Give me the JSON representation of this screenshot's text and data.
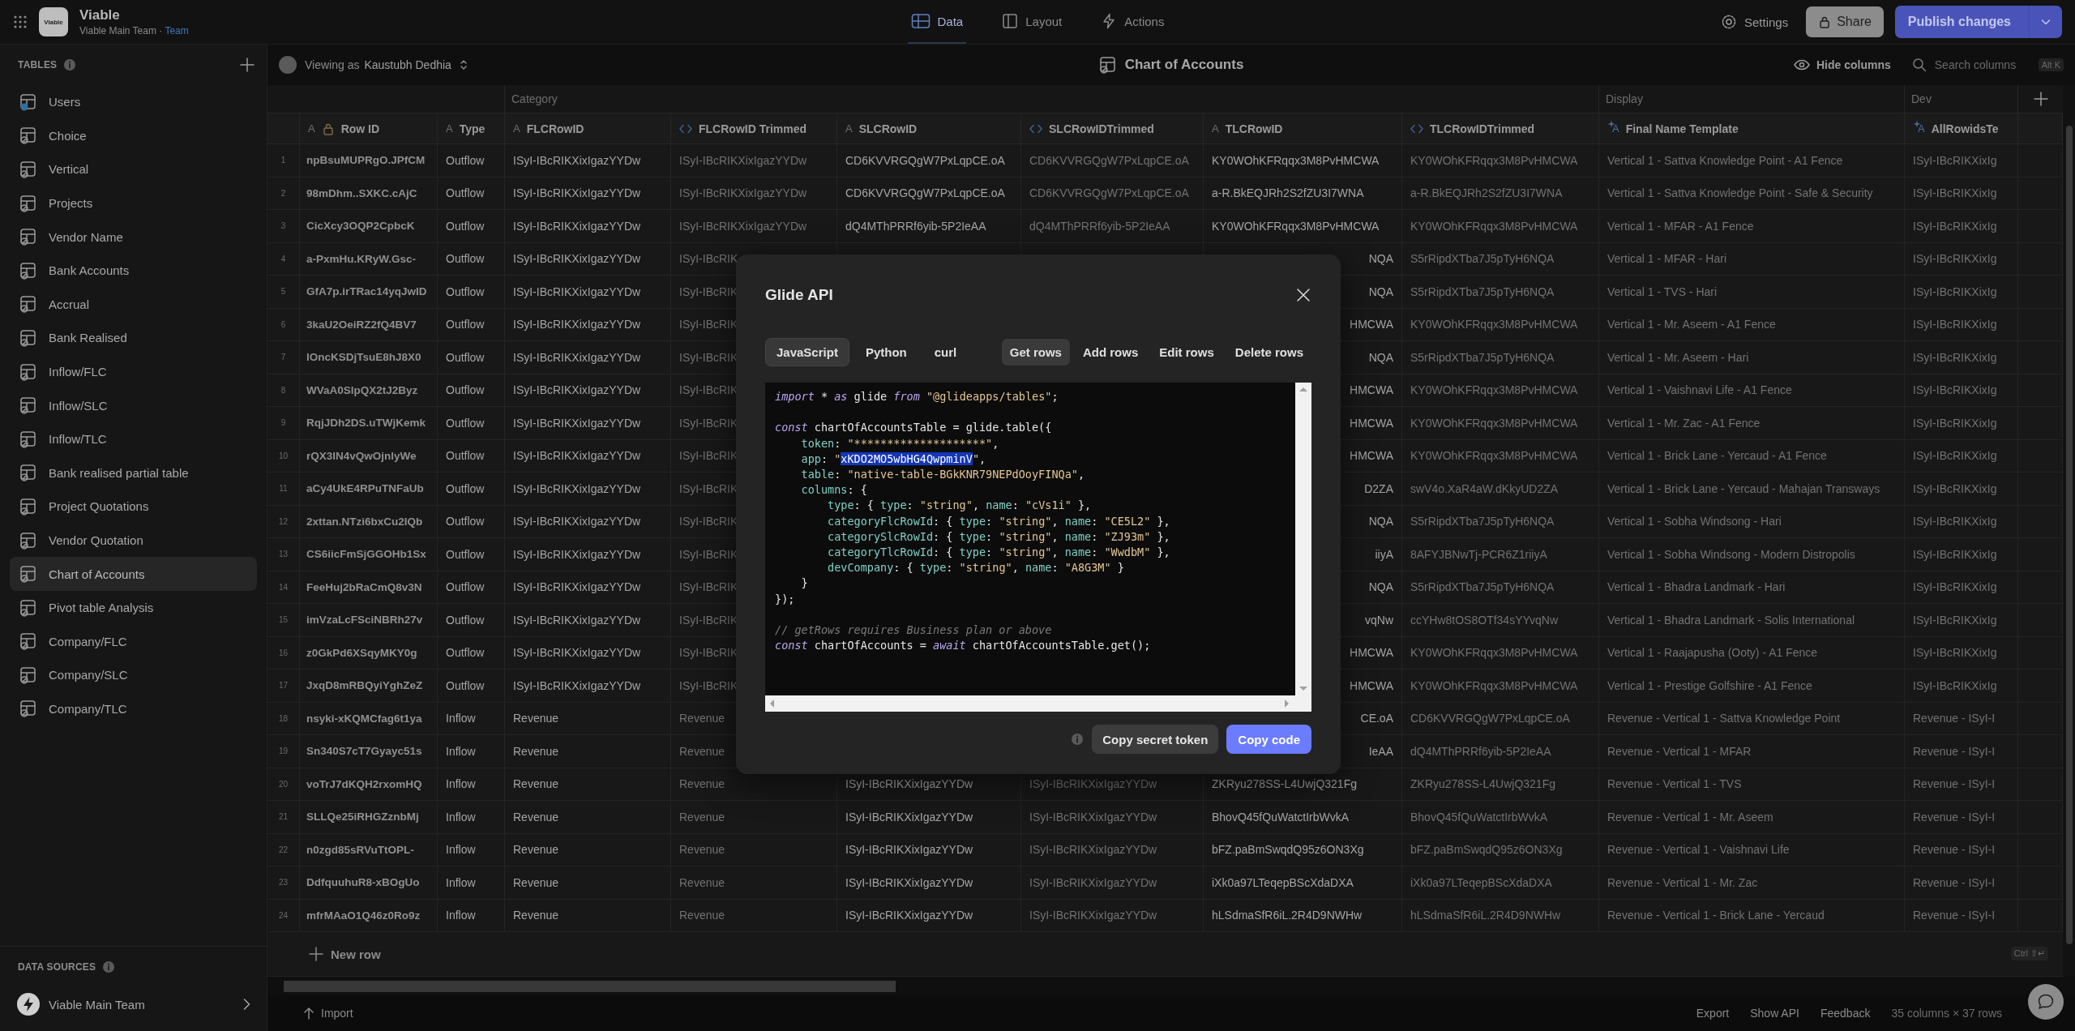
{
  "app": {
    "logo_text": "Viable",
    "name": "Viable",
    "team": "Viable Main Team",
    "dot": "·",
    "plan": "Team"
  },
  "nav": [
    {
      "label": "Data",
      "kind": "data",
      "selected": true
    },
    {
      "label": "Layout",
      "kind": "layout",
      "selected": false
    },
    {
      "label": "Actions",
      "kind": "actions",
      "selected": false
    }
  ],
  "header_actions": {
    "settings": "Settings",
    "share": "Share",
    "publish": "Publish changes"
  },
  "sidebar": {
    "title": "TABLES",
    "items": [
      {
        "label": "Users",
        "kind": "users",
        "selected": false
      },
      {
        "label": "Choice",
        "kind": "table",
        "selected": false
      },
      {
        "label": "Vertical",
        "kind": "table",
        "selected": false
      },
      {
        "label": "Projects",
        "kind": "table",
        "selected": false
      },
      {
        "label": "Vendor Name",
        "kind": "table",
        "selected": false
      },
      {
        "label": "Bank Accounts",
        "kind": "table",
        "selected": false
      },
      {
        "label": "Accrual",
        "kind": "table",
        "selected": false
      },
      {
        "label": "Bank Realised",
        "kind": "table",
        "selected": false
      },
      {
        "label": "Inflow/FLC",
        "kind": "table",
        "selected": false
      },
      {
        "label": "Inflow/SLC",
        "kind": "table",
        "selected": false
      },
      {
        "label": "Inflow/TLC",
        "kind": "table",
        "selected": false
      },
      {
        "label": "Bank realised partial table",
        "kind": "table",
        "selected": false
      },
      {
        "label": "Project Quotations",
        "kind": "table",
        "selected": false
      },
      {
        "label": "Vendor Quotation",
        "kind": "table",
        "selected": false
      },
      {
        "label": "Chart of Accounts",
        "kind": "table",
        "selected": true
      },
      {
        "label": "Pivot table Analysis",
        "kind": "table",
        "selected": false
      },
      {
        "label": "Company/FLC",
        "kind": "table",
        "selected": false
      },
      {
        "label": "Company/SLC",
        "kind": "table",
        "selected": false
      },
      {
        "label": "Company/TLC",
        "kind": "table",
        "selected": false
      }
    ],
    "data_sources_title": "DATA SOURCES",
    "source": "Viable Main Team"
  },
  "toolbar": {
    "viewing_prefix": "Viewing as",
    "viewer": "Kaustubh Dedhia",
    "table_title": "Chart of Accounts",
    "hide_columns": "Hide columns",
    "search_placeholder": "Search columns",
    "shortcut": "Alt K"
  },
  "table": {
    "column_sets": [
      {
        "columns": [
          {
            "label": "Row ID",
            "kind": "text",
            "glyph": "A",
            "locked": true
          },
          {
            "label": "Type",
            "kind": "text",
            "glyph": "A",
            "locked": false
          }
        ]
      },
      {
        "label": "Category",
        "columns": [
          {
            "label": "FLCRowID",
            "kind": "text",
            "glyph": "A",
            "locked": false
          },
          {
            "label": "FLCRowID Trimmed",
            "kind": "computed",
            "locked": false
          },
          {
            "label": "SLCRowID",
            "kind": "text",
            "glyph": "A",
            "locked": false
          },
          {
            "label": "SLCRowIDTrimmed",
            "kind": "computed",
            "locked": false
          },
          {
            "label": "TLCRowID",
            "kind": "text",
            "glyph": "A",
            "locked": false
          },
          {
            "label": "TLCRowIDTrimmed",
            "kind": "computed",
            "locked": false
          }
        ]
      },
      {
        "label": "Display",
        "columns": [
          {
            "label": "Final Name Template",
            "kind": "template",
            "glyph": "A",
            "locked": false
          }
        ]
      },
      {
        "label": "Dev",
        "columns": [
          {
            "label": "AllRowidsTe",
            "kind": "template",
            "glyph": "A",
            "locked": false
          }
        ]
      }
    ],
    "rows": [
      {
        "num": "1",
        "cells": [
          "npBsuMUPRgO.JPfCM",
          "Outflow",
          "ISyI-IBcRIKXixIgazYYDw",
          "ISyI-IBcRIKXixIgazYYDw",
          "CD6KVVRGQgW7PxLqpCE.oA",
          "CD6KVVRGQgW7PxLqpCE.oA",
          "KY0WOhKFRqqx3M8PvHMCWA",
          "KY0WOhKFRqqx3M8PvHMCWA",
          "Vertical 1 - Sattva Knowledge Point - A1 Fence",
          "ISyI-IBcRIKXixIg"
        ]
      },
      {
        "num": "2",
        "cells": [
          "98mDhm..SXKC.cAjC",
          "Outflow",
          "ISyI-IBcRIKXixIgazYYDw",
          "ISyI-IBcRIKXixIgazYYDw",
          "CD6KVVRGQgW7PxLqpCE.oA",
          "CD6KVVRGQgW7PxLqpCE.oA",
          "a-R.BkEQJRh2S2fZU3I7WNA",
          "a-R.BkEQJRh2S2fZU3I7WNA",
          "Vertical 1 - Sattva Knowledge Point - Safe & Security",
          "ISyI-IBcRIKXixIg"
        ]
      },
      {
        "num": "3",
        "cells": [
          "CicXcy3OQP2CpbcK",
          "Outflow",
          "ISyI-IBcRIKXixIgazYYDw",
          "ISyI-IBcRIKXixIgazYYDw",
          "dQ4MThPRRf6yib-5P2IeAA",
          "dQ4MThPRRf6yib-5P2IeAA",
          "KY0WOhKFRqqx3M8PvHMCWA",
          "KY0WOhKFRqqx3M8PvHMCWA",
          "Vertical 1 - MFAR - A1 Fence",
          "ISyI-IBcRIKXixIg"
        ]
      },
      {
        "num": "4",
        "cells": [
          "a-PxmHu.KRyW.Gsc-",
          "Outflow",
          "ISyI-IBcRIKXixIgazYYDw",
          "ISyI-IBcRIK",
          null,
          null,
          {
            "text": "NQA",
            "cut_left": true
          },
          "S5rRipdXTba7J5pTyH6NQA",
          "Vertical 1 - MFAR - Hari",
          "ISyI-IBcRIKXixIg"
        ]
      },
      {
        "num": "5",
        "cells": [
          "GfA7p.irTRac14yqJwID",
          "Outflow",
          "ISyI-IBcRIKXixIgazYYDw",
          "ISyI-IBcRIK",
          null,
          null,
          {
            "text": "NQA",
            "cut_left": true
          },
          "S5rRipdXTba7J5pTyH6NQA",
          "Vertical 1 - TVS - Hari",
          "ISyI-IBcRIKXixIg"
        ]
      },
      {
        "num": "6",
        "cells": [
          "3kaU2OeiRZ2fQ4BV7",
          "Outflow",
          "ISyI-IBcRIKXixIgazYYDw",
          "ISyI-IBcRIK",
          null,
          null,
          {
            "text": "HMCWA",
            "cut_left": true
          },
          "KY0WOhKFRqqx3M8PvHMCWA",
          "Vertical 1 - Mr. Aseem - A1 Fence",
          "ISyI-IBcRIKXixIg"
        ]
      },
      {
        "num": "7",
        "cells": [
          "lOncKSDjTsuE8hJ8X0",
          "Outflow",
          "ISyI-IBcRIKXixIgazYYDw",
          "ISyI-IBcRIK",
          null,
          null,
          {
            "text": "NQA",
            "cut_left": true
          },
          "S5rRipdXTba7J5pTyH6NQA",
          "Vertical 1 - Mr. Aseem - Hari",
          "ISyI-IBcRIKXixIg"
        ]
      },
      {
        "num": "8",
        "cells": [
          "WVaA0SlpQX2tJ2Byz",
          "Outflow",
          "ISyI-IBcRIKXixIgazYYDw",
          "ISyI-IBcRIK",
          null,
          null,
          {
            "text": "HMCWA",
            "cut_left": true
          },
          "KY0WOhKFRqqx3M8PvHMCWA",
          "Vertical 1 - Vaishnavi Life - A1 Fence",
          "ISyI-IBcRIKXixIg"
        ]
      },
      {
        "num": "9",
        "cells": [
          "RqjJDh2DS.uTWjKemk",
          "Outflow",
          "ISyI-IBcRIKXixIgazYYDw",
          "ISyI-IBcRIK",
          null,
          null,
          {
            "text": "HMCWA",
            "cut_left": true
          },
          "KY0WOhKFRqqx3M8PvHMCWA",
          "Vertical 1 - Mr. Zac - A1 Fence",
          "ISyI-IBcRIKXixIg"
        ]
      },
      {
        "num": "10",
        "cells": [
          "rQX3IN4vQwOjnlyWe",
          "Outflow",
          "ISyI-IBcRIKXixIgazYYDw",
          "ISyI-IBcRIK",
          null,
          null,
          {
            "text": "HMCWA",
            "cut_left": true
          },
          "KY0WOhKFRqqx3M8PvHMCWA",
          "Vertical 1 - Brick Lane - Yercaud - A1 Fence",
          "ISyI-IBcRIKXixIg"
        ]
      },
      {
        "num": "11",
        "cells": [
          "aCy4UkE4RPuTNFaUb",
          "Outflow",
          "ISyI-IBcRIKXixIgazYYDw",
          "ISyI-IBcRIK",
          null,
          null,
          {
            "text": "D2ZA",
            "cut_left": true
          },
          "swV4o.XaR4aW.dKkyUD2ZA",
          "Vertical 1 - Brick Lane - Yercaud - Mahajan Transways",
          "ISyI-IBcRIKXixIg"
        ]
      },
      {
        "num": "12",
        "cells": [
          "2xttan.NTzi6bxCu2IQb",
          "Outflow",
          "ISyI-IBcRIKXixIgazYYDw",
          "ISyI-IBcRIK",
          null,
          null,
          {
            "text": "NQA",
            "cut_left": true
          },
          "S5rRipdXTba7J5pTyH6NQA",
          "Vertical 1 - Sobha Windsong - Hari",
          "ISyI-IBcRIKXixIg"
        ]
      },
      {
        "num": "13",
        "cells": [
          "CS6iicFmSjGGOHb1Sx",
          "Outflow",
          "ISyI-IBcRIKXixIgazYYDw",
          "ISyI-IBcRIK",
          null,
          null,
          {
            "text": "iiyA",
            "cut_left": true
          },
          "8AFYJBNwTj-PCR6Z1riiyA",
          "Vertical 1 - Sobha Windsong - Modern Distropolis",
          "ISyI-IBcRIKXixIg"
        ]
      },
      {
        "num": "14",
        "cells": [
          "FeeHuj2bRaCmQ8v3N",
          "Outflow",
          "ISyI-IBcRIKXixIgazYYDw",
          "ISyI-IBcRIK",
          null,
          null,
          {
            "text": "NQA",
            "cut_left": true
          },
          "S5rRipdXTba7J5pTyH6NQA",
          "Vertical 1 - Bhadra Landmark - Hari",
          "ISyI-IBcRIKXixIg"
        ]
      },
      {
        "num": "15",
        "cells": [
          "imVzaLcFSciNBRh27v",
          "Outflow",
          "ISyI-IBcRIKXixIgazYYDw",
          "ISyI-IBcRIK",
          null,
          null,
          {
            "text": "vqNw",
            "cut_left": true
          },
          "ccYHw8tOS8OTf34sYYvqNw",
          "Vertical 1 - Bhadra Landmark - Solis International",
          "ISyI-IBcRIKXixIg"
        ]
      },
      {
        "num": "16",
        "cells": [
          "z0GkPd6XSqyMKY0g",
          "Outflow",
          "ISyI-IBcRIKXixIgazYYDw",
          "ISyI-IBcRIK",
          null,
          null,
          {
            "text": "HMCWA",
            "cut_left": true
          },
          "KY0WOhKFRqqx3M8PvHMCWA",
          "Vertical 1 - Raajapusha (Ooty) - A1 Fence",
          "ISyI-IBcRIKXixIg"
        ]
      },
      {
        "num": "17",
        "cells": [
          "JxqD8mRBQyiYghZeZ",
          "Outflow",
          "ISyI-IBcRIKXixIgazYYDw",
          "ISyI-IBcRIK",
          null,
          null,
          {
            "text": "HMCWA",
            "cut_left": true
          },
          "KY0WOhKFRqqx3M8PvHMCWA",
          "Vertical 1 - Prestige Golfshire - A1 Fence",
          "ISyI-IBcRIKXixIg"
        ]
      },
      {
        "num": "18",
        "cells": [
          "nsyki-xKQMCfag6t1ya",
          "Inflow",
          "Revenue",
          "Revenue",
          null,
          null,
          {
            "text": "CE.oA",
            "cut_left": true
          },
          "CD6KVVRGQgW7PxLqpCE.oA",
          "Revenue - Vertical 1 - Sattva Knowledge Point",
          "Revenue - ISyI-I"
        ]
      },
      {
        "num": "19",
        "cells": [
          "Sn340S7cT7Gyayc51s",
          "Inflow",
          "Revenue",
          "Revenue",
          null,
          null,
          {
            "text": "IeAA",
            "cut_left": true
          },
          "dQ4MThPRRf6yib-5P2IeAA",
          "Revenue - Vertical 1 - MFAR",
          "Revenue - ISyI-I"
        ]
      },
      {
        "num": "20",
        "cells": [
          "voTrJ7dKQH2rxomHQ",
          "Inflow",
          "Revenue",
          "Revenue",
          "ISyI-IBcRIKXixIgazYYDw",
          "ISyI-IBcRIKXixIgazYYDw",
          "ZKRyu278SS-L4UwjQ321Fg",
          "ZKRyu278SS-L4UwjQ321Fg",
          "Revenue - Vertical 1 - TVS",
          "Revenue - ISyI-I"
        ]
      },
      {
        "num": "21",
        "cells": [
          "SLLQe25iRHGZznbMj",
          "Inflow",
          "Revenue",
          "Revenue",
          "ISyI-IBcRIKXixIgazYYDw",
          "ISyI-IBcRIKXixIgazYYDw",
          "BhovQ45fQuWatctIrbWvkA",
          "BhovQ45fQuWatctIrbWvkA",
          "Revenue - Vertical 1 - Mr. Aseem",
          "Revenue - ISyI-I"
        ]
      },
      {
        "num": "22",
        "cells": [
          "n0zgd85sRVuTtOPL-",
          "Inflow",
          "Revenue",
          "Revenue",
          "ISyI-IBcRIKXixIgazYYDw",
          "ISyI-IBcRIKXixIgazYYDw",
          "bFZ.paBmSwqdQ95z6ON3Xg",
          "bFZ.paBmSwqdQ95z6ON3Xg",
          "Revenue - Vertical 1 - Vaishnavi Life",
          "Revenue - ISyI-I"
        ]
      },
      {
        "num": "23",
        "cells": [
          "DdfquuhuR8-xBOgUo",
          "Inflow",
          "Revenue",
          "Revenue",
          "ISyI-IBcRIKXixIgazYYDw",
          "ISyI-IBcRIKXixIgazYYDw",
          "iXk0a97LTeqepBScXdaDXA",
          "iXk0a97LTeqepBScXdaDXA",
          "Revenue - Vertical 1 - Mr. Zac",
          "Revenue - ISyI-I"
        ]
      },
      {
        "num": "24",
        "cells": [
          "mfrMAaO1Q46z0Ro9z",
          "Inflow",
          "Revenue",
          "Revenue",
          "ISyI-IBcRIKXixIgazYYDw",
          "ISyI-IBcRIKXixIgazYYDw",
          "hLSdmaSfR6iL.2R4D9NWHw",
          "hLSdmaSfR6iL.2R4D9NWHw",
          "Revenue - Vertical 1 - Brick Lane - Yercaud",
          "Revenue - ISyI-I"
        ]
      }
    ],
    "new_row": "New row",
    "shortcut": "Ctrl ⇧↵"
  },
  "footer": {
    "import": "Import",
    "links": [
      "Export",
      "Show API",
      "Feedback"
    ],
    "summary": "35 columns × 37 rows"
  },
  "dialog": {
    "title": "Glide API",
    "languages": [
      {
        "label": "JavaScript",
        "selected": true
      },
      {
        "label": "Python",
        "selected": false
      },
      {
        "label": "curl",
        "selected": false
      }
    ],
    "operations": [
      {
        "label": "Get rows",
        "selected": true
      },
      {
        "label": "Add rows",
        "selected": false
      },
      {
        "label": "Edit rows",
        "selected": false
      },
      {
        "label": "Delete rows",
        "selected": false
      }
    ],
    "code_blocks": [
      [
        [
          {
            "kind": "keyword",
            "text": "import"
          },
          {
            "kind": "plain",
            "text": " * "
          },
          {
            "kind": "keyword",
            "text": "as"
          },
          {
            "kind": "plain",
            "text": " glide "
          },
          {
            "kind": "keyword",
            "text": "from"
          },
          {
            "kind": "string",
            "text": " \"@glideapps/tables\""
          },
          {
            "kind": "plain",
            "text": ";"
          }
        ]
      ],
      [
        [
          {
            "kind": "keyword",
            "text": "const"
          },
          {
            "kind": "plain",
            "text": " chartOfAccountsTable = glide.table({"
          }
        ],
        [
          {
            "kind": "property",
            "text": "    token"
          },
          {
            "kind": "plain",
            "text": ": "
          },
          {
            "kind": "string",
            "text": "\"********************\""
          },
          {
            "kind": "plain",
            "text": ","
          }
        ],
        [
          {
            "kind": "property",
            "text": "    app"
          },
          {
            "kind": "plain",
            "text": ": "
          },
          {
            "kind": "string",
            "text": "\""
          },
          {
            "kind": "selection",
            "text": "xKDO2MO5wbHG4QwpminV"
          },
          {
            "kind": "string",
            "text": "\""
          },
          {
            "kind": "plain",
            "text": ","
          }
        ],
        [
          {
            "kind": "property",
            "text": "    table"
          },
          {
            "kind": "plain",
            "text": ": "
          },
          {
            "kind": "string",
            "text": "\"native-table-BGkKNR79NEPdOoyFINQa\""
          },
          {
            "kind": "plain",
            "text": ","
          }
        ],
        [
          {
            "kind": "property",
            "text": "    columns"
          },
          {
            "kind": "plain",
            "text": ": {"
          }
        ],
        [
          {
            "kind": "property",
            "text": "        type"
          },
          {
            "kind": "plain",
            "text": ": { "
          },
          {
            "kind": "property",
            "text": "type"
          },
          {
            "kind": "plain",
            "text": ": "
          },
          {
            "kind": "string",
            "text": "\"string\""
          },
          {
            "kind": "plain",
            "text": ", "
          },
          {
            "kind": "property",
            "text": "name"
          },
          {
            "kind": "plain",
            "text": ": "
          },
          {
            "kind": "string",
            "text": "\"cVs1i\""
          },
          {
            "kind": "plain",
            "text": " },"
          }
        ],
        [
          {
            "kind": "property",
            "text": "        categoryFlcRowId"
          },
          {
            "kind": "plain",
            "text": ": { "
          },
          {
            "kind": "property",
            "text": "type"
          },
          {
            "kind": "plain",
            "text": ": "
          },
          {
            "kind": "string",
            "text": "\"string\""
          },
          {
            "kind": "plain",
            "text": ", "
          },
          {
            "kind": "property",
            "text": "name"
          },
          {
            "kind": "plain",
            "text": ": "
          },
          {
            "kind": "string",
            "text": "\"CE5L2\""
          },
          {
            "kind": "plain",
            "text": " },"
          }
        ],
        [
          {
            "kind": "property",
            "text": "        categorySlcRowId"
          },
          {
            "kind": "plain",
            "text": ": { "
          },
          {
            "kind": "property",
            "text": "type"
          },
          {
            "kind": "plain",
            "text": ": "
          },
          {
            "kind": "string",
            "text": "\"string\""
          },
          {
            "kind": "plain",
            "text": ", "
          },
          {
            "kind": "property",
            "text": "name"
          },
          {
            "kind": "plain",
            "text": ": "
          },
          {
            "kind": "string",
            "text": "\"ZJ93m\""
          },
          {
            "kind": "plain",
            "text": " },"
          }
        ],
        [
          {
            "kind": "property",
            "text": "        categoryTlcRowId"
          },
          {
            "kind": "plain",
            "text": ": { "
          },
          {
            "kind": "property",
            "text": "type"
          },
          {
            "kind": "plain",
            "text": ": "
          },
          {
            "kind": "string",
            "text": "\"string\""
          },
          {
            "kind": "plain",
            "text": ", "
          },
          {
            "kind": "property",
            "text": "name"
          },
          {
            "kind": "plain",
            "text": ": "
          },
          {
            "kind": "string",
            "text": "\"WwdbM\""
          },
          {
            "kind": "plain",
            "text": " },"
          }
        ],
        [
          {
            "kind": "property",
            "text": "        devCompany"
          },
          {
            "kind": "plain",
            "text": ": { "
          },
          {
            "kind": "property",
            "text": "type"
          },
          {
            "kind": "plain",
            "text": ": "
          },
          {
            "kind": "string",
            "text": "\"string\""
          },
          {
            "kind": "plain",
            "text": ", "
          },
          {
            "kind": "property",
            "text": "name"
          },
          {
            "kind": "plain",
            "text": ": "
          },
          {
            "kind": "string",
            "text": "\"A8G3M\""
          },
          {
            "kind": "plain",
            "text": " }"
          }
        ],
        [
          {
            "kind": "plain",
            "text": "    }"
          }
        ],
        [
          {
            "kind": "plain",
            "text": "});"
          }
        ]
      ],
      [
        [
          {
            "kind": "comment",
            "text": "// getRows requires Business plan or above"
          }
        ],
        [
          {
            "kind": "keyword",
            "text": "const"
          },
          {
            "kind": "plain",
            "text": " chartOfAccounts = "
          },
          {
            "kind": "keyword",
            "text": "await"
          },
          {
            "kind": "plain",
            "text": " chartOfAccountsTable.get();"
          }
        ]
      ]
    ],
    "copy_token": "Copy secret token",
    "copy_code": "Copy code"
  }
}
